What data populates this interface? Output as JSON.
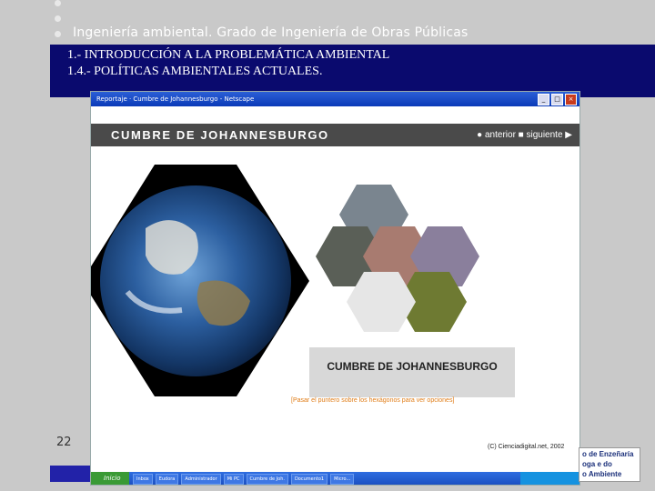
{
  "slide": {
    "course_title": "Ingeniería ambiental. Grado de Ingeniería de Obras Públicas",
    "heading_line1": "1.- INTRODUCCIÓN A LA PROBLEMÁTICA AMBIENTAL",
    "heading_line2": "1.4.- POLÍTICAS AMBIENTALES ACTUALES.",
    "page_number": "22"
  },
  "browser": {
    "window_title": "Reportaje · Cumbre de Johannesburgo - Netscape",
    "banner_title": "CUMBRE DE JOHANNESBURGO",
    "nav_text": "● anterior ■ siguiente ▶",
    "subtitle": "CUMBRE DE JOHANNESBURGO",
    "hint": "[Pasar el puntero sobre los hexágonos para ver opciones]",
    "copyright": "(C) Cienciadigital.net, 2002"
  },
  "taskbar": {
    "start_label": "Inicio",
    "items": [
      "Inbox",
      "Eudora",
      "Administrador",
      "Mi PC",
      "Cumbre de Joh.",
      "Documento1",
      "Micro..."
    ]
  },
  "logo": {
    "line1": "o de Enzeñaría",
    "line2": "oga e do",
    "line3": "o Ambiente"
  },
  "colors": {
    "title_bar": "#0a0a6e",
    "banner": "#4a4a4a",
    "hint": "#e07c16"
  }
}
